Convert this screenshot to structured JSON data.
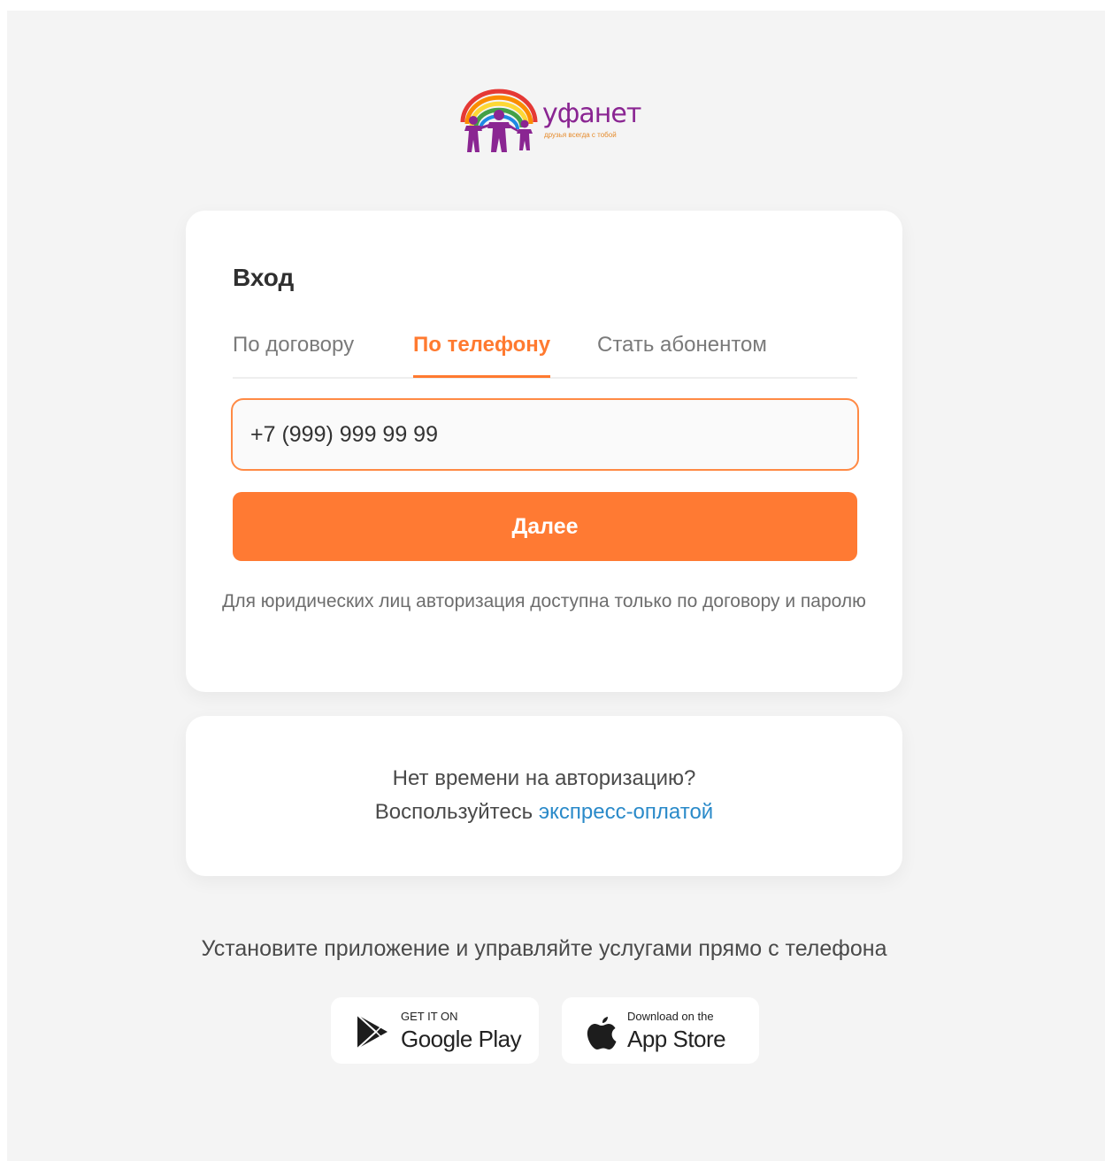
{
  "brand": {
    "name": "уфанет",
    "tagline": "друзья всегда с тобой",
    "colors": {
      "accent": "#ff7a33",
      "logo_purple": "#8a2592",
      "link": "#2a8ac9"
    }
  },
  "login": {
    "title": "Вход",
    "tabs": [
      {
        "label": "По договору",
        "active": false
      },
      {
        "label": "По телефону",
        "active": true
      },
      {
        "label": "Стать абонентом",
        "active": false
      }
    ],
    "phone_value": "+7 (999) 999 99 99",
    "next_label": "Далее",
    "legal_note": "Для юридических лиц авторизация доступна только по договору и паролю"
  },
  "express": {
    "line1": "Нет времени на авторизацию?",
    "line2_prefix": "Воспользуйтесь",
    "link_text": "экспресс-оплатой"
  },
  "apps": {
    "promo": "Установите приложение и управляйте услугами прямо с телефона",
    "google": {
      "small": "GET IT ON",
      "big": "Google Play",
      "icon": "play-icon"
    },
    "apple": {
      "small": "Download on the",
      "big": "App Store",
      "icon": "apple-icon"
    }
  }
}
